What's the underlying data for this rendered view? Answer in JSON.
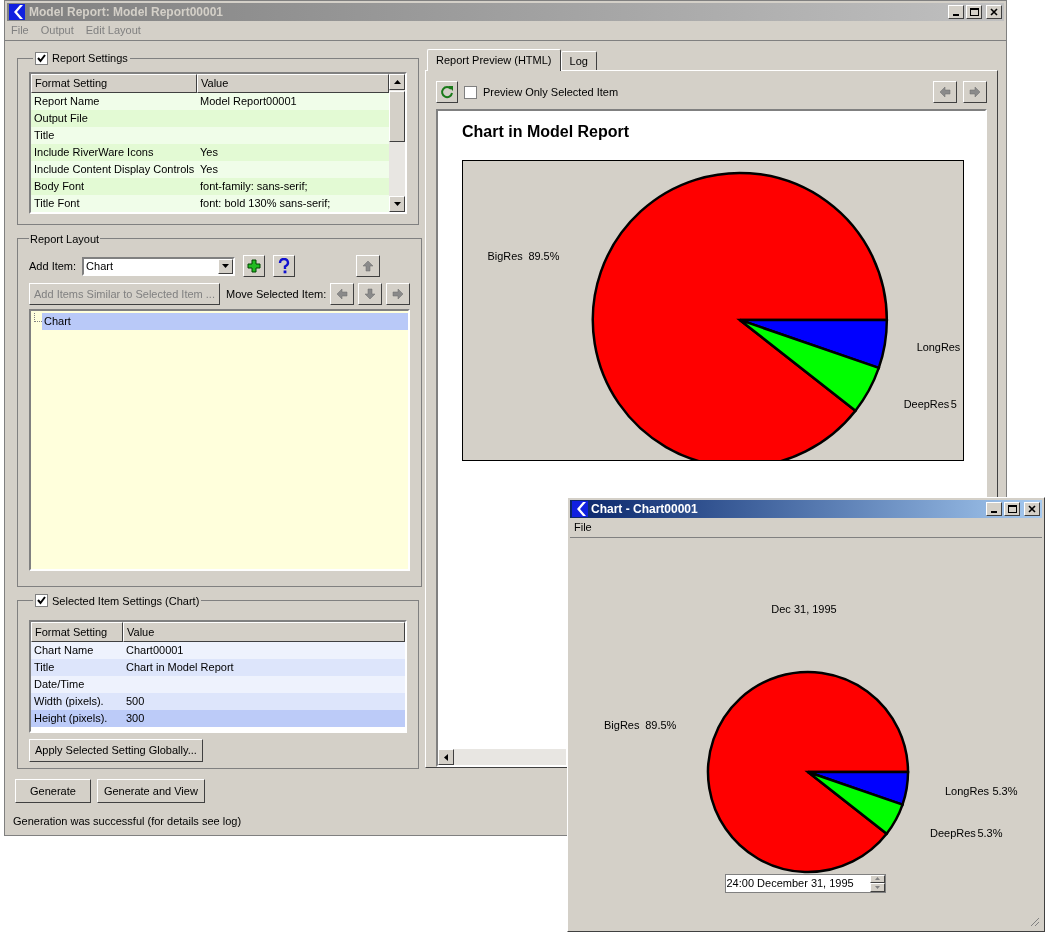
{
  "main_window": {
    "title": "Model Report: Model Report00001",
    "menu": [
      "File",
      "Output",
      "Edit Layout"
    ]
  },
  "report_settings": {
    "label": "Report Settings",
    "checked": true,
    "columns": [
      "Format Setting",
      "Value"
    ],
    "rows": [
      {
        "setting": "Report Name",
        "value": "Model Report00001"
      },
      {
        "setting": "Output File"
      },
      {
        "setting": "Title"
      },
      {
        "setting": "Include RiverWare Icons",
        "value": "Yes"
      },
      {
        "setting": "Include Content Display Controls",
        "value": "Yes"
      },
      {
        "setting": "Body Font",
        "value": "font-family: sans-serif;"
      },
      {
        "setting": "Title Font",
        "value": "font: bold 130% sans-serif;"
      }
    ]
  },
  "report_layout": {
    "label": "Report Layout",
    "add_item_label": "Add Item:",
    "add_item_value": "Chart",
    "add_similar_button": {
      "label": "Add Items Similar to Selected Item ...",
      "disabled": true
    },
    "move_label": "Move Selected Item:",
    "tree": [
      {
        "label": "Chart",
        "selected": true
      }
    ]
  },
  "selected_item_settings": {
    "label": "Selected Item Settings (Chart)",
    "checked": true,
    "columns": [
      "Format Setting",
      "Value"
    ],
    "rows": [
      {
        "setting": "Chart Name",
        "value": "Chart00001",
        "selected": false
      },
      {
        "setting": "Title",
        "value": "Chart in Model Report",
        "selected": false
      },
      {
        "setting": "Date/Time",
        "selected": false
      },
      {
        "setting": "Width (pixels).",
        "value": "500",
        "selected": false
      },
      {
        "setting": "Height (pixels).",
        "value": "300",
        "selected": true
      }
    ],
    "apply_button": "Apply Selected Setting Globally..."
  },
  "buttons": [
    "Generate",
    "Generate and View"
  ],
  "status": "Generation was successful (for details see log)",
  "preview": {
    "tabs": [
      {
        "label": "Report Preview (HTML)",
        "selected": true
      },
      {
        "label": "Log",
        "selected": false
      }
    ],
    "preview_only_selected": {
      "label": "Preview Only Selected Item",
      "checked": false
    },
    "report_title": "Chart in Model Report",
    "chart_data": {
      "type": "pie",
      "categories": [
        "BigRes",
        "LongRes",
        "DeepRes"
      ],
      "values": [
        89.5,
        5.3,
        5.3
      ],
      "colors": [
        "#ff0000",
        "#0000ff",
        "#00ff00"
      ],
      "value_labels": [
        "89.5%",
        null,
        "5"
      ]
    }
  },
  "chart_window": {
    "title": "Chart - Chart00001",
    "menu": [
      "File"
    ],
    "date_label": "Dec 31, 1995",
    "chart_data": {
      "type": "pie",
      "categories": [
        "BigRes",
        "LongRes",
        "DeepRes"
      ],
      "values": [
        89.5,
        5.3,
        5.3
      ],
      "colors": [
        "#ff0000",
        "#0000ff",
        "#00ff00"
      ],
      "value_labels": [
        "89.5%",
        "5.3%",
        "5.3%"
      ]
    },
    "date_field": "24:00 December 31, 1995"
  }
}
